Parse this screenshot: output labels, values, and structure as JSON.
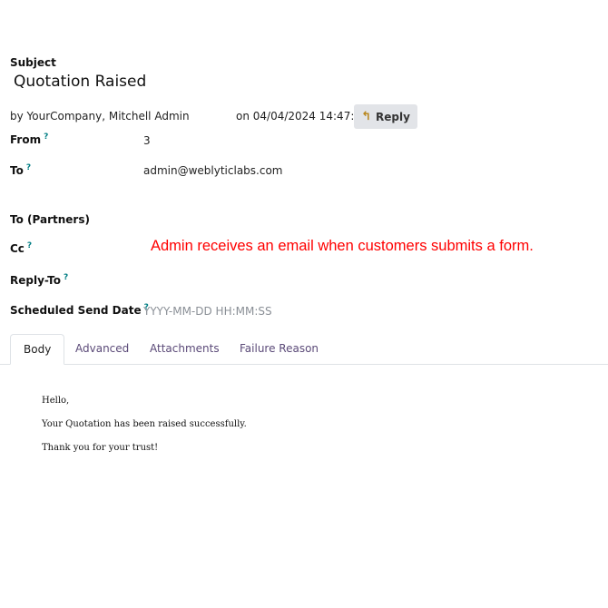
{
  "subject": {
    "label": "Subject",
    "value": "Quotation Raised"
  },
  "meta": {
    "by_text": "by  YourCompany, Mitchell Admin",
    "date_text": "on 04/04/2024 14:47:38",
    "reply_label": "Reply",
    "reply_icon": "reply-arrow-icon"
  },
  "fields": {
    "from": {
      "label": "From",
      "help": "?",
      "value": "3"
    },
    "to": {
      "label": "To",
      "help": "?",
      "value": "admin@weblyticlabs.com"
    },
    "to_partners": {
      "label": "To (Partners)"
    },
    "cc": {
      "label": "Cc",
      "help": "?"
    },
    "reply_to": {
      "label": "Reply-To",
      "help": "?"
    },
    "scheduled": {
      "label": "Scheduled Send Date",
      "help": "?",
      "placeholder": "YYYY-MM-DD HH:MM:SS"
    }
  },
  "annotation": "Admin receives an email when customers submits a form.",
  "tabs": [
    {
      "label": "Body",
      "active": true
    },
    {
      "label": "Advanced",
      "active": false
    },
    {
      "label": "Attachments",
      "active": false
    },
    {
      "label": "Failure Reason",
      "active": false
    }
  ],
  "body": {
    "greeting": "Hello,",
    "line1": "Your Quotation has been raised successfully.",
    "line2": "Thank you for your trust!"
  },
  "colors": {
    "accent": "#017e84",
    "tab_link": "#5b4a78",
    "annotation": "#ff0000",
    "reply_bg": "#e2e4e8"
  }
}
